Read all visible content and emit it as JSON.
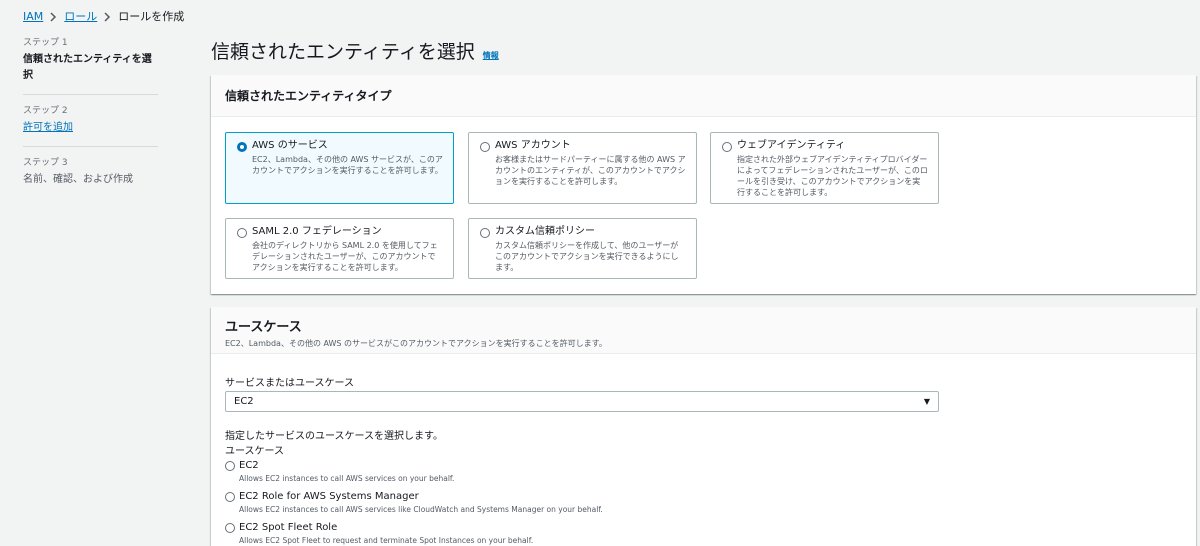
{
  "breadcrumb": {
    "iam": "IAM",
    "roles": "ロール",
    "current": "ロールを作成"
  },
  "steps": [
    {
      "num": "ステップ 1",
      "title": "信頼されたエンティティを選択"
    },
    {
      "num": "ステップ 2",
      "title": "許可を追加"
    },
    {
      "num": "ステップ 3",
      "title": "名前、確認、および作成"
    }
  ],
  "header": {
    "title": "信頼されたエンティティを選択",
    "info": "情報"
  },
  "entity_panel": {
    "title": "信頼されたエンティティタイプ",
    "tiles": [
      {
        "title": "AWS のサービス",
        "desc": "EC2、Lambda、その他の AWS サービスが、このアカウントでアクションを実行することを許可します。",
        "selected": true
      },
      {
        "title": "AWS アカウント",
        "desc": "お客様またはサードパーティーに属する他の AWS アカウントのエンティティが、このアカウントでアクションを実行することを許可します。",
        "selected": false
      },
      {
        "title": "ウェブアイデンティティ",
        "desc": "指定された外部ウェブアイデンティティプロバイダーによってフェデレーションされたユーザーが、このロールを引き受け、このアカウントでアクションを実行することを許可します。",
        "selected": false
      },
      {
        "title": "SAML 2.0 フェデレーション",
        "desc": "会社のディレクトリから SAML 2.0 を使用してフェデレーションされたユーザーが、このアカウントでアクションを実行することを許可します。",
        "selected": false
      },
      {
        "title": "カスタム信頼ポリシー",
        "desc": "カスタム信頼ポリシーを作成して、他のユーザーがこのアカウントでアクションを実行できるようにします。",
        "selected": false
      }
    ]
  },
  "usecase_panel": {
    "title": "ユースケース",
    "desc": "EC2、Lambda、その他の AWS のサービスがこのアカウントでアクションを実行することを許可します。",
    "service_label": "サービスまたはユースケース",
    "service_value": "EC2",
    "select_hint": "指定したサービスのユースケースを選択します。",
    "usecase_label": "ユースケース",
    "options": [
      {
        "title": "EC2",
        "desc": "Allows EC2 instances to call AWS services on your behalf.",
        "selected": true
      },
      {
        "title": "EC2 Role for AWS Systems Manager",
        "desc": "Allows EC2 instances to call AWS services like CloudWatch and Systems Manager on your behalf.",
        "selected": false
      },
      {
        "title": "EC2 Spot Fleet Role",
        "desc": "Allows EC2 Spot Fleet to request and terminate Spot Instances on your behalf.",
        "selected": false
      }
    ]
  },
  "colors": {
    "link": "#0073bb",
    "selected_border": "#00a1c9",
    "selected_bg": "#f1faff",
    "page_bg": "#f2f3f3"
  }
}
